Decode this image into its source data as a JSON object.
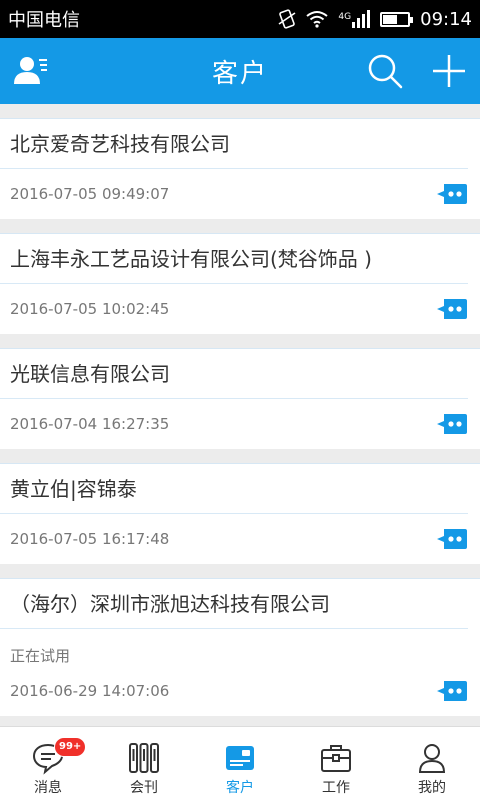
{
  "status_bar": {
    "carrier": "中国电信",
    "network": "4G",
    "time": "09:14",
    "battery_level": 0.55
  },
  "header": {
    "title": "客户",
    "left_icon": "contacts-icon",
    "search_icon": "search-icon",
    "add_icon": "plus-icon"
  },
  "customers": [
    {
      "name": "北京爱奇艺科技有限公司",
      "status": "",
      "date": "2016-07-05 09:49:07"
    },
    {
      "name": "上海丰永工艺品设计有限公司(梵谷饰品 )",
      "status": "",
      "date": "2016-07-05 10:02:45"
    },
    {
      "name": "光联信息有限公司",
      "status": "",
      "date": "2016-07-04 16:27:35"
    },
    {
      "name": "黄立伯|容锦泰",
      "status": "",
      "date": "2016-07-05 16:17:48"
    },
    {
      "name": "（海尔）深圳市涨旭达科技有限公司",
      "status": "正在试用",
      "date": "2016-06-29 14:07:06"
    }
  ],
  "bottom_nav": {
    "items": [
      {
        "label": "消息",
        "icon": "message-icon",
        "badge": "99+"
      },
      {
        "label": "会刊",
        "icon": "catalog-icon"
      },
      {
        "label": "客户",
        "icon": "customer-card-icon",
        "active": true
      },
      {
        "label": "工作",
        "icon": "briefcase-icon"
      },
      {
        "label": "我的",
        "icon": "profile-icon"
      }
    ]
  },
  "colors": {
    "brand": "#1499e6",
    "badge": "#f0302a"
  }
}
